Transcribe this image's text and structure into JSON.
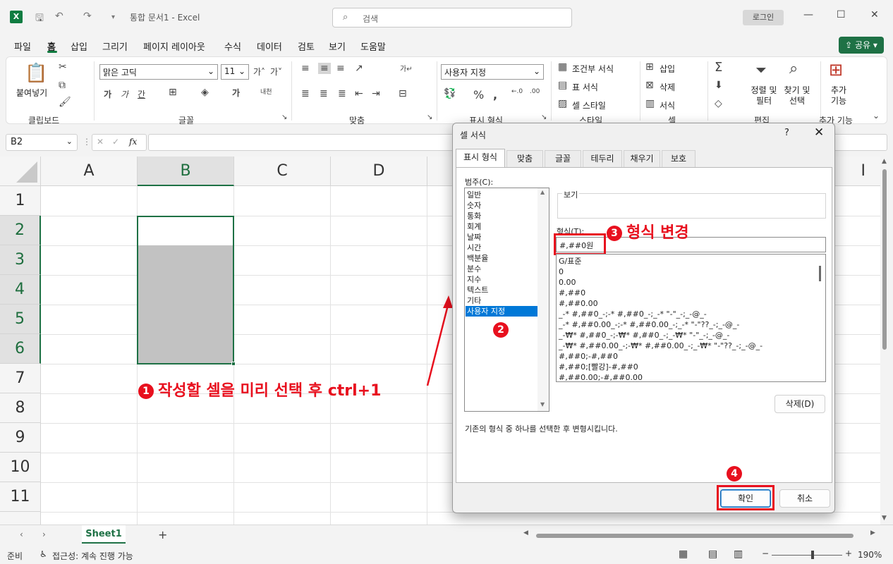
{
  "window": {
    "app_icon": "X",
    "title": "통합 문서1  -  Excel",
    "search_icon": "⌕",
    "search_placeholder": "검색",
    "login": "로그인"
  },
  "ribbon_tabs": [
    "파일",
    "홈",
    "삽입",
    "그리기",
    "페이지 레이아웃",
    "수식",
    "데이터",
    "검토",
    "보기",
    "도움말"
  ],
  "share": "공유",
  "ribbon": {
    "paste": "붙여넣기",
    "clipboard": "클립보드",
    "font_name": "맑은 고딕",
    "font_size": "11",
    "font": "글꼴",
    "alignment": "맞춤",
    "number_format": "사용자 지정",
    "number": "표시 형식",
    "cond_format": "조건부 서식",
    "table_format": "표 서식",
    "cell_style": "셀 스타일",
    "styles": "스타일",
    "insert": "삽입",
    "delete": "삭제",
    "format": "서식",
    "cells": "셀",
    "sort_filter": "정렬 및 필터",
    "find_select": "찾기 및 선택",
    "editing": "편집",
    "addins": "추가 기능",
    "addins_group": "추가 기능"
  },
  "namebox": "B2",
  "fx": "fx",
  "columns": [
    "A",
    "B",
    "C",
    "D"
  ],
  "extra_col": "I",
  "rows": [
    "1",
    "2",
    "3",
    "4",
    "5",
    "6",
    "7",
    "8",
    "9",
    "10",
    "11"
  ],
  "annotation_1": "작성할 셀을 미리 선택 후 ctrl+1",
  "annotation_2": "2",
  "annotation_3": "형식 변경",
  "annotation_4": "4",
  "badge_1": "1",
  "badge_3": "3",
  "sheet_tab": "Sheet1",
  "status": {
    "ready": "준비",
    "accessibility": "접근성: 계속 진행 가능",
    "zoom": "190%"
  },
  "dialog": {
    "title": "셀 서식",
    "help": "?",
    "close": "✕",
    "tabs": [
      "표시 형식",
      "맞춤",
      "글꼴",
      "테두리",
      "채우기",
      "보호"
    ],
    "category_label": "범주(C):",
    "categories": [
      "일반",
      "숫자",
      "통화",
      "회계",
      "날짜",
      "시간",
      "백분율",
      "분수",
      "지수",
      "텍스트",
      "기타",
      "사용자 지정"
    ],
    "sample_label": "보기",
    "type_label": "형식(T):",
    "type_value": "#,##0원",
    "formats": [
      "G/표준",
      "0",
      "0.00",
      "#,##0",
      "#,##0.00",
      "_-* #,##0_-;-* #,##0_-;_-* \"-\"_-;_-@_-",
      "_-* #,##0.00_-;-* #,##0.00_-;_-* \"-\"??_-;_-@_-",
      "_-₩* #,##0_-;-₩* #,##0_-;_-₩* \"-\"_-;_-@_-",
      "_-₩* #,##0.00_-;-₩* #,##0.00_-;_-₩* \"-\"??_-;_-@_-",
      "#,##0;-#,##0",
      "#,##0;[빨강]-#,##0",
      "#,##0.00;-#,##0.00"
    ],
    "delete_btn": "삭제(D)",
    "description": "기존의 형식 중 하나를 선택한 후 변형시킵니다.",
    "ok": "확인",
    "cancel": "취소"
  },
  "colors": {
    "excel_green": "#1e7145",
    "annotation_red": "#e8101e",
    "selection_blue": "#0078d7"
  }
}
